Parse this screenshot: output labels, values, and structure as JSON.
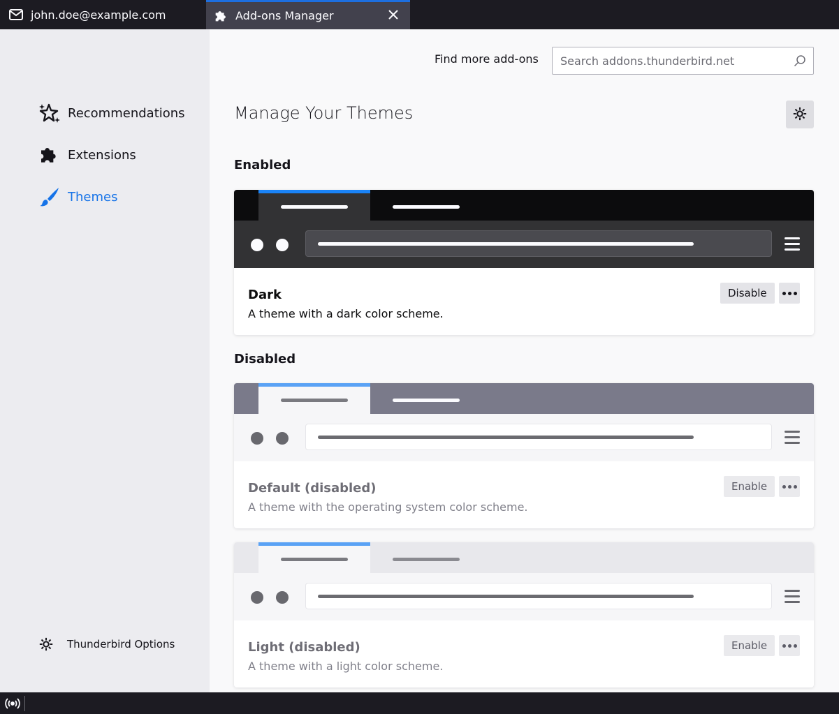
{
  "tabs": {
    "mail": {
      "label": "john.doe@example.com",
      "icon": "envelope-icon"
    },
    "addons": {
      "label": "Add-ons Manager",
      "icon": "puzzle-icon"
    }
  },
  "sidebar": {
    "items": [
      {
        "label": "Recommendations",
        "icon": "sparkle-icon",
        "selected": false
      },
      {
        "label": "Extensions",
        "icon": "puzzle-icon",
        "selected": false
      },
      {
        "label": "Themes",
        "icon": "paintbrush-icon",
        "selected": true
      }
    ],
    "footer": {
      "label": "Thunderbird Options",
      "icon": "gear-icon"
    },
    "accent": "#1673e8"
  },
  "main": {
    "find_label": "Find more add-ons",
    "search_placeholder": "Search addons.thunderbird.net",
    "title": "Manage Your Themes",
    "sections": {
      "enabled": "Enabled",
      "disabled": "Disabled"
    },
    "themes": [
      {
        "name": "Dark",
        "description": "A theme with a dark color scheme.",
        "action": "Disable",
        "status": "enabled"
      },
      {
        "name": "Default (disabled)",
        "description": "A theme with the operating system color scheme.",
        "action": "Enable",
        "status": "disabled"
      },
      {
        "name": "Light (disabled)",
        "description": "A theme with a light color scheme.",
        "action": "Enable",
        "status": "disabled"
      }
    ]
  },
  "colors": {
    "tab_indicator": "#1d6fe0",
    "preview_indicator": "#5aa2f5"
  }
}
